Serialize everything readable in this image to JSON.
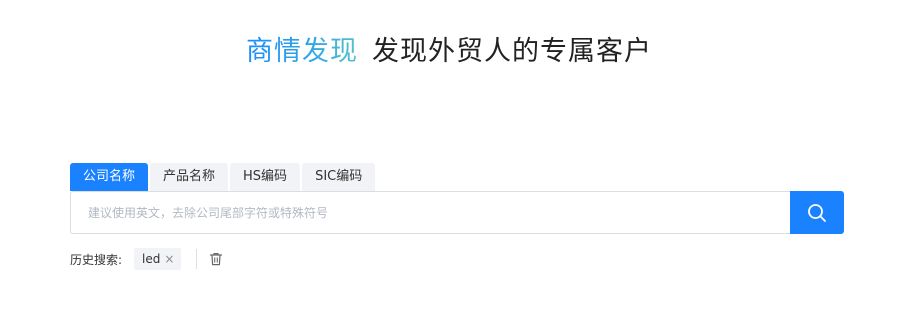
{
  "hero": {
    "brand": "商情发现",
    "slogan": "发现外贸人的专属客户"
  },
  "tabs": [
    {
      "label": "公司名称",
      "active": true
    },
    {
      "label": "产品名称",
      "active": false
    },
    {
      "label": "HS编码",
      "active": false
    },
    {
      "label": "SIC编码",
      "active": false
    }
  ],
  "search": {
    "value": "",
    "placeholder": "建议使用英文，去除公司尾部字符或特殊符号",
    "button_icon": "search-icon"
  },
  "history": {
    "label": "历史搜索:",
    "items": [
      {
        "text": "led",
        "close_icon": "close-icon"
      }
    ],
    "clear_icon": "trash-icon"
  },
  "colors": {
    "primary": "#1a82ff",
    "brand_gradient_start": "#1a8cff",
    "brand_gradient_end": "#55c1c8",
    "tab_bg": "#f1f3f7",
    "text": "#333333",
    "placeholder": "#b3b8c2"
  }
}
